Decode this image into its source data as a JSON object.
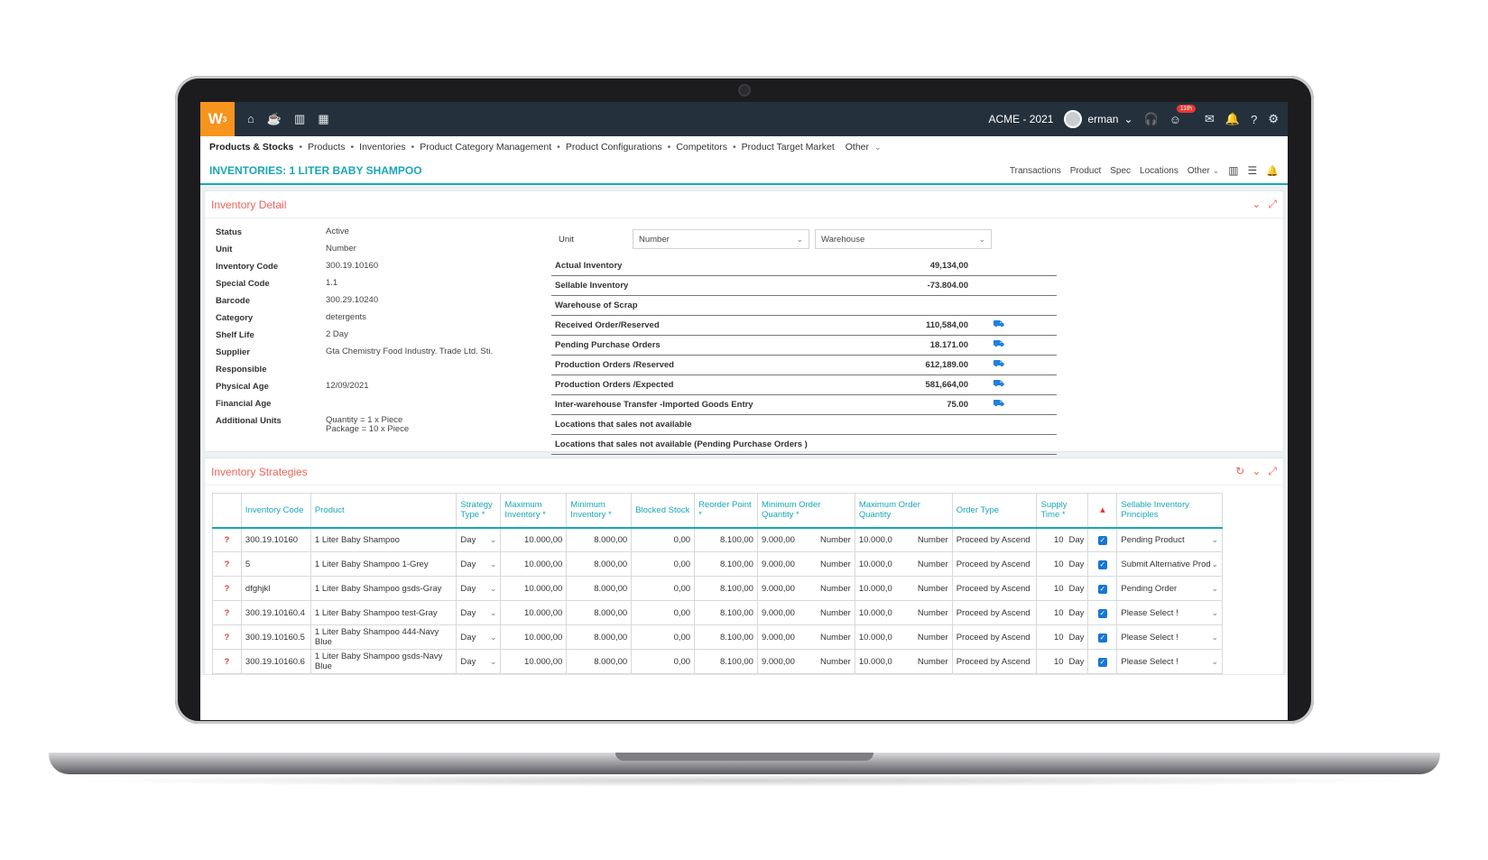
{
  "topbar": {
    "logo_text": "W",
    "logo_sup": "3",
    "company": "ACME - 2021",
    "user": "erman",
    "badge": "11th"
  },
  "breadcrumb": {
    "items": [
      "Products & Stocks",
      "Products",
      "Inventories",
      "Product Category Management",
      "Product Configurations",
      "Competitors",
      "Product Target Market",
      "Other"
    ]
  },
  "page": {
    "title": "INVENTORIES: 1 LITER BABY SHAMPOO",
    "actions": [
      "Transactions",
      "Product",
      "Spec",
      "Locations",
      "Other"
    ]
  },
  "detail": {
    "title": "Inventory Detail",
    "fields": [
      {
        "key": "Status",
        "value": "Active"
      },
      {
        "key": "Unit",
        "value": "Number"
      },
      {
        "key": "Inventory Code",
        "value": "300.19.10160"
      },
      {
        "key": "Special Code",
        "value": "1.1"
      },
      {
        "key": "Barcode",
        "value": "300.29.10240"
      },
      {
        "key": "Category",
        "value": "detergents"
      },
      {
        "key": "Shelf Life",
        "value": "2 Day"
      },
      {
        "key": "Supplier",
        "value": "Gta Chemistry Food Industry. Trade Ltd. Sti."
      },
      {
        "key": "Responsible",
        "value": ""
      },
      {
        "key": "Physical Age",
        "value": "12/09/2021"
      },
      {
        "key": "Financial Age",
        "value": ""
      },
      {
        "key": "Additional Units",
        "value": "Quantity = 1 x Piece",
        "value2": "Package = 10 x Piece"
      }
    ],
    "unit_label": "Unit",
    "unit_select": "Number",
    "warehouse_select": "Warehouse",
    "inventory": [
      {
        "label": "Actual Inventory",
        "value": "49,134,00",
        "icon": false
      },
      {
        "label": "Sellable Inventory",
        "value": "-73.804.00",
        "icon": false
      },
      {
        "label": "Warehouse of Scrap",
        "value": "",
        "icon": false
      },
      {
        "label": "Received Order/Reserved",
        "value": "110,584,00",
        "icon": true
      },
      {
        "label": "Pending Purchase Orders",
        "value": "18.171.00",
        "icon": true
      },
      {
        "label": "Production Orders /Reserved",
        "value": "612,189.00",
        "icon": true
      },
      {
        "label": "Production Orders /Expected",
        "value": "581,664,00",
        "icon": true
      },
      {
        "label": "Inter-warehouse Transfer -Imported Goods Entry",
        "value": "75.00",
        "icon": true
      },
      {
        "label": "Locations that sales not available",
        "value": "",
        "icon": false
      },
      {
        "label": "Locations that sales not available (Pending Purchase Orders )",
        "value": "",
        "icon": false
      }
    ]
  },
  "strategies": {
    "title": "Inventory Strategies",
    "headers": [
      "Inventory Code",
      "Product",
      "Strategy Type *",
      "Maximum Inventory *",
      "Minimum Inventory *",
      "Blocked Stock",
      "Reorder Point *",
      "Minimum Order Quantity *",
      "Maximum Order Quantity",
      "Order Type",
      "Supply Time *",
      "",
      "Sellable Inventory Principles"
    ],
    "rows": [
      {
        "code": "300.19.10160",
        "product": "1 Liter Baby Shampoo",
        "type": "Day",
        "max": "10.000,00",
        "min": "8.000,00",
        "blocked": "0,00",
        "reorder": "8.100,00",
        "minq": "9.000,00",
        "minq_unit": "Number",
        "maxq": "10.000,0",
        "maxq_unit": "Number",
        "order_type": "Proceed by Ascend",
        "supply": "10",
        "supply_unit": "Day",
        "principle": "Pending Product"
      },
      {
        "code": "5",
        "product": "1 Liter Baby Shampoo 1-Grey",
        "type": "Day",
        "max": "10.000,00",
        "min": "8.000,00",
        "blocked": "0,00",
        "reorder": "8.100,00",
        "minq": "9.000,00",
        "minq_unit": "Number",
        "maxq": "10.000,0",
        "maxq_unit": "Number",
        "order_type": "Proceed by Ascend",
        "supply": "10",
        "supply_unit": "Day",
        "principle": "Submit Alternative Produ"
      },
      {
        "code": "dfghjkl",
        "product": "1 Liter Baby Shampoo gsds-Gray",
        "type": "Day",
        "max": "10.000,00",
        "min": "8.000,00",
        "blocked": "0,00",
        "reorder": "8.100,00",
        "minq": "9.000,00",
        "minq_unit": "Number",
        "maxq": "10.000,0",
        "maxq_unit": "Number",
        "order_type": "Proceed by Ascend",
        "supply": "10",
        "supply_unit": "Day",
        "principle": "Pending Order"
      },
      {
        "code": "300.19.10160.4",
        "product": "1 Liter Baby Shampoo test-Gray",
        "type": "Day",
        "max": "10.000,00",
        "min": "8.000,00",
        "blocked": "0,00",
        "reorder": "8.100,00",
        "minq": "9.000,00",
        "minq_unit": "Number",
        "maxq": "10.000,0",
        "maxq_unit": "Number",
        "order_type": "Proceed by Ascend",
        "supply": "10",
        "supply_unit": "Day",
        "principle": "Please Select !"
      },
      {
        "code": "300.19.10160.5",
        "product": "1 Liter Baby Shampoo 444-Navy Blue",
        "type": "Day",
        "max": "10.000,00",
        "min": "8.000,00",
        "blocked": "0,00",
        "reorder": "8.100,00",
        "minq": "9.000,00",
        "minq_unit": "Number",
        "maxq": "10.000,0",
        "maxq_unit": "Number",
        "order_type": "Proceed by Ascend",
        "supply": "10",
        "supply_unit": "Day",
        "principle": "Please Select !"
      },
      {
        "code": "300.19.10160.6",
        "product": "1 Liter Baby Shampoo gsds-Navy Blue",
        "type": "Day",
        "max": "10.000,00",
        "min": "8.000,00",
        "blocked": "0,00",
        "reorder": "8.100,00",
        "minq": "9.000,00",
        "minq_unit": "Number",
        "maxq": "10.000,0",
        "maxq_unit": "Number",
        "order_type": "Proceed by Ascend",
        "supply": "10",
        "supply_unit": "Day",
        "principle": "Please Select !"
      }
    ]
  },
  "colors": {
    "accent": "#19a6b6",
    "logo": "#f7941d",
    "panel_title": "#e8655a",
    "topbar": "#24313d"
  }
}
